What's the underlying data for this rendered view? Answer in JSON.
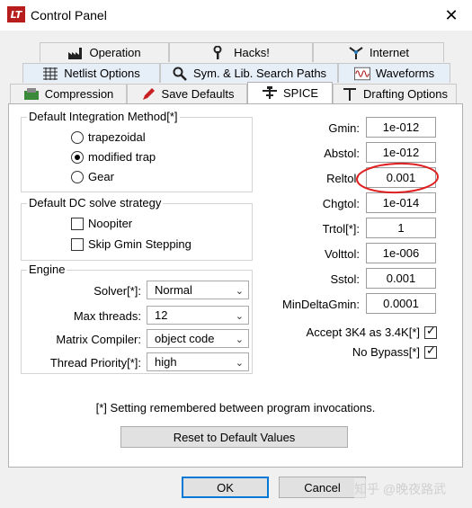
{
  "window": {
    "title": "Control Panel",
    "close_glyph": "✕",
    "app_icon_text": "LT"
  },
  "tabs": {
    "row1": [
      "Operation",
      "Hacks!",
      "Internet"
    ],
    "row2": [
      "Netlist Options",
      "Sym. & Lib. Search Paths",
      "Waveforms"
    ],
    "row3": [
      "Compression",
      "Save Defaults",
      "SPICE",
      "Drafting Options"
    ],
    "icons": {
      "operation": "factory-icon",
      "hacks": "wrench-icon",
      "internet": "antenna-icon",
      "netlist": "netlist-icon",
      "search_paths": "magnifier-icon",
      "waveforms": "waveform-icon",
      "compression": "compression-icon",
      "save_defaults": "pencil-icon",
      "spice": "spice-icon",
      "drafting": "drafting-icon"
    },
    "active": "SPICE"
  },
  "integration": {
    "title": "Default Integration Method[*]",
    "options": [
      "trapezoidal",
      "modified trap",
      "Gear"
    ],
    "selected": "modified trap"
  },
  "dc_solve": {
    "title": "Default DC solve strategy",
    "noopiter": "Noopiter",
    "skip_gmin": "Skip Gmin Stepping",
    "noopiter_checked": false,
    "skip_gmin_checked": false
  },
  "engine": {
    "title": "Engine",
    "solver_label": "Solver[*]:",
    "solver_value": "Normal",
    "threads_label": "Max threads:",
    "threads_value": "12",
    "compiler_label": "Matrix Compiler:",
    "compiler_value": "object code",
    "priority_label": "Thread Priority[*]:",
    "priority_value": "high"
  },
  "params": [
    {
      "label": "Gmin:",
      "value": "1e-012"
    },
    {
      "label": "Abstol:",
      "value": "1e-012"
    },
    {
      "label": "Reltol:",
      "value": "0.001"
    },
    {
      "label": "Chgtol:",
      "value": "1e-014"
    },
    {
      "label": "Trtol[*]:",
      "value": "1"
    },
    {
      "label": "Volttol:",
      "value": "1e-006"
    },
    {
      "label": "Sstol:",
      "value": "0.001"
    },
    {
      "label": "MinDeltaGmin:",
      "value": "0.0001"
    }
  ],
  "checks": {
    "accept_3k4": "Accept 3K4 as 3.4K[*]",
    "no_bypass": "No Bypass[*]",
    "accept_3k4_checked": true,
    "no_bypass_checked": true
  },
  "footnote": "[*] Setting remembered between program invocations.",
  "buttons": {
    "reset": "Reset to Default Values",
    "ok": "OK",
    "cancel": "Cancel"
  },
  "watermark": "知乎 @晚夜路武",
  "colors": {
    "highlight_ellipse": "#e02020",
    "default_button_border": "#0078d7",
    "selected_tab_row": "#e6eef8"
  }
}
